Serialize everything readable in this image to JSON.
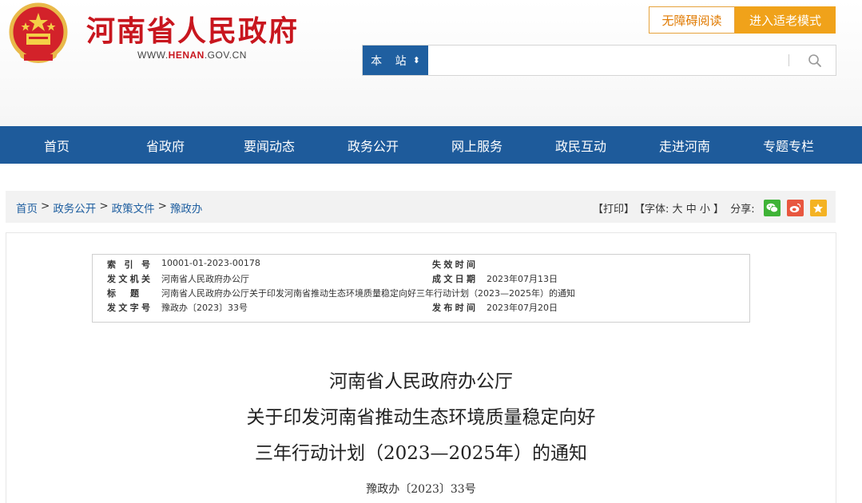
{
  "header": {
    "site_name": "河南省人民政府",
    "site_url_prefix": "WWW.",
    "site_url_brand": "HENAN",
    "site_url_suffix": ".GOV.CN",
    "btn_accessible": "无障碍阅读",
    "btn_elder": "进入适老模式"
  },
  "search": {
    "scope_label": "本 站",
    "placeholder": "",
    "value": ""
  },
  "nav": {
    "items": [
      "首页",
      "省政府",
      "要闻动态",
      "政务公开",
      "网上服务",
      "政民互动",
      "走进河南",
      "专题专栏"
    ]
  },
  "breadcrumb": {
    "items": [
      "首页",
      "政务公开",
      "政策文件",
      "豫政办"
    ],
    "separator": ">"
  },
  "tools": {
    "print": "【打印】",
    "font_label": "【字体:",
    "font_large": "大",
    "font_medium": "中",
    "font_small": "小",
    "font_close": "】",
    "share_label": "分享:"
  },
  "meta": {
    "index_key": "索引号",
    "index_val": "10001-01-2023-00178",
    "expire_key": "失效时间",
    "expire_val": "",
    "issuer_key": "发文机关",
    "issuer_val": "河南省人民政府办公厅",
    "date_key": "成文日期",
    "date_val": "2023年07月13日",
    "title_key": "标题",
    "title_val": "河南省人民政府办公厅关于印发河南省推动生态环境质量稳定向好三年行动计划（2023—2025年）的通知",
    "docno_key": "发文字号",
    "docno_val": "豫政办〔2023〕33号",
    "publish_key": "发布时间",
    "publish_val": "2023年07月20日"
  },
  "document": {
    "title_line1": "河南省人民政府办公厅",
    "title_line2": "关于印发河南省推动生态环境质量稳定向好",
    "title_line3": "三年行动计划（2023—2025年）的通知",
    "doc_number": "豫政办〔2023〕33号"
  },
  "colors": {
    "brand_red": "#c8161e",
    "nav_blue": "#1e5b9b",
    "elder_orange": "#f0a21a"
  }
}
